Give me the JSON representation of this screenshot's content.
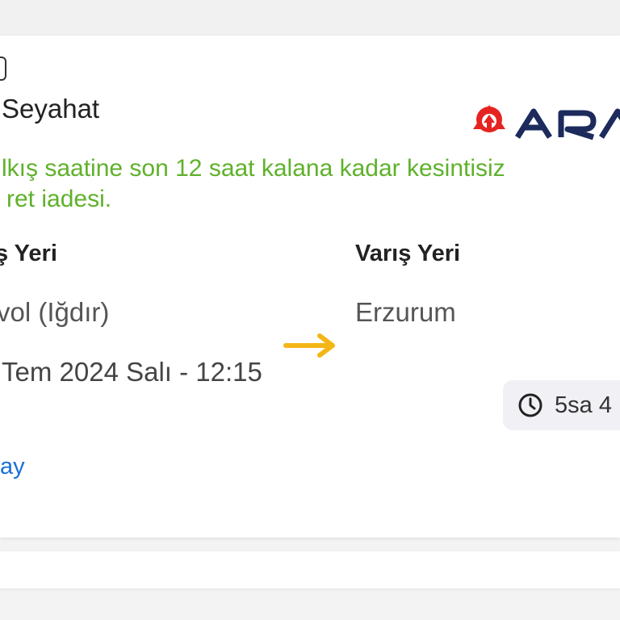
{
  "company": {
    "name": "Seyahat"
  },
  "logo": {
    "text": "ARA",
    "mark_color": "#e52421",
    "text_color": "#1c2a5c"
  },
  "refund_note": {
    "line1": "lkış saatine son 12 saat kalana kadar kesintisiz",
    "line2": "ret iadesi.",
    "color": "#5fb12a"
  },
  "route": {
    "departure_label": "ş Yeri",
    "arrival_label": "Varış Yeri",
    "departure_city": "vol (Iğdır)",
    "arrival_city": "Erzurum",
    "arrow_icon": "arrow-right-icon",
    "arrow_color": "#f3b617"
  },
  "trip": {
    "datetime": "Tem 2024 Salı - 12:15",
    "duration": "5sa 4",
    "clock_icon": "clock-icon"
  },
  "detail": {
    "link_text": "ay",
    "color": "#1a6fd6"
  }
}
